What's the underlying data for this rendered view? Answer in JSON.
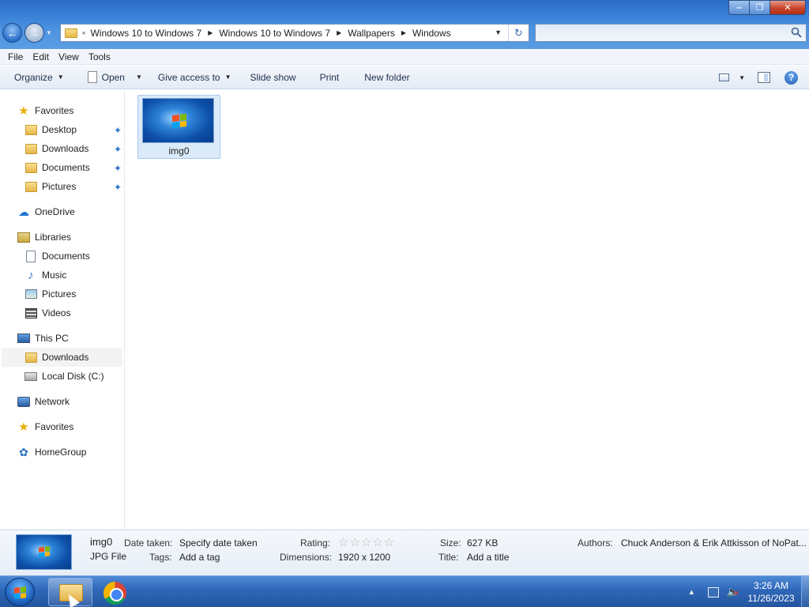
{
  "window": {
    "caption": {
      "minimize": "‒",
      "maximize": "❐",
      "close": "✕"
    }
  },
  "address": {
    "overflow": "«",
    "crumbs": [
      "Windows 10 to Windows 7",
      "Windows 10 to Windows 7",
      "Wallpapers",
      "Windows"
    ],
    "separator": "▶"
  },
  "search": {
    "placeholder": ""
  },
  "menu": {
    "items": [
      "File",
      "Edit",
      "View",
      "Tools"
    ]
  },
  "toolbar": {
    "organize": "Organize",
    "open": "Open",
    "give_access": "Give access to",
    "slideshow": "Slide show",
    "print": "Print",
    "new_folder": "New folder"
  },
  "nav": {
    "favorites": "Favorites",
    "desktop": "Desktop",
    "downloads": "Downloads",
    "documents": "Documents",
    "pictures": "Pictures",
    "onedrive": "OneDrive",
    "libraries": "Libraries",
    "lib_documents": "Documents",
    "lib_music": "Music",
    "lib_pictures": "Pictures",
    "lib_videos": "Videos",
    "this_pc": "This PC",
    "pc_downloads": "Downloads",
    "local_disk": "Local Disk (C:)",
    "network": "Network",
    "favorites2": "Favorites",
    "homegroup": "HomeGroup"
  },
  "files": [
    {
      "name": "img0",
      "icon": "windows-wallpaper-thumbnail"
    }
  ],
  "details": {
    "name": "img0",
    "type": "JPG File",
    "date_taken_label": "Date taken:",
    "date_taken_value": "Specify date taken",
    "tags_label": "Tags:",
    "tags_value": "Add a tag",
    "rating_label": "Rating:",
    "rating_stars": "☆☆☆☆☆",
    "rating_value": 0,
    "dimensions_label": "Dimensions:",
    "dimensions_value": "1920 x 1200",
    "size_label": "Size:",
    "size_value": "627 KB",
    "title_label": "Title:",
    "title_value": "Add a title",
    "authors_label": "Authors:",
    "authors_value": "Chuck Anderson & Erik Attkisson of NoPat..."
  },
  "taskbar": {
    "apps": [
      "file-explorer",
      "google-chrome"
    ],
    "time": "3:26 AM",
    "date": "11/26/2023"
  },
  "colors": {
    "titlebar": "#3b83d8",
    "taskbar": "#2f67b8",
    "selection": "#dbeaf9"
  }
}
